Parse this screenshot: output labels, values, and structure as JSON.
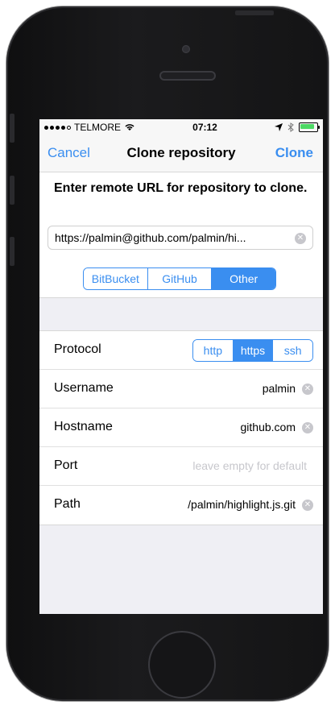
{
  "status": {
    "carrier": "TELMORE",
    "time": "07:12"
  },
  "nav": {
    "cancel": "Cancel",
    "title": "Clone repository",
    "clone": "Clone"
  },
  "repo": {
    "prompt": "Enter remote URL for repository to clone.",
    "url": "https://palmin@github.com/palmin/hi...",
    "providers": [
      "BitBucket",
      "GitHub",
      "Other"
    ],
    "selected_provider": "Other"
  },
  "form": {
    "protocol": {
      "label": "Protocol",
      "options": [
        "http",
        "https",
        "ssh"
      ],
      "selected": "https"
    },
    "username": {
      "label": "Username",
      "value": "palmin"
    },
    "hostname": {
      "label": "Hostname",
      "value": "github.com"
    },
    "port": {
      "label": "Port",
      "placeholder": "leave empty for default"
    },
    "path": {
      "label": "Path",
      "value": "/palmin/highlight.js.git"
    }
  },
  "colors": {
    "accent": "#3a8ef0",
    "battery": "#4cd964"
  },
  "icons": {
    "wifi": "wifi-icon",
    "location": "location-arrow-icon",
    "bluetooth": "bluetooth-icon",
    "battery": "battery-icon",
    "clear": "clear-icon"
  }
}
